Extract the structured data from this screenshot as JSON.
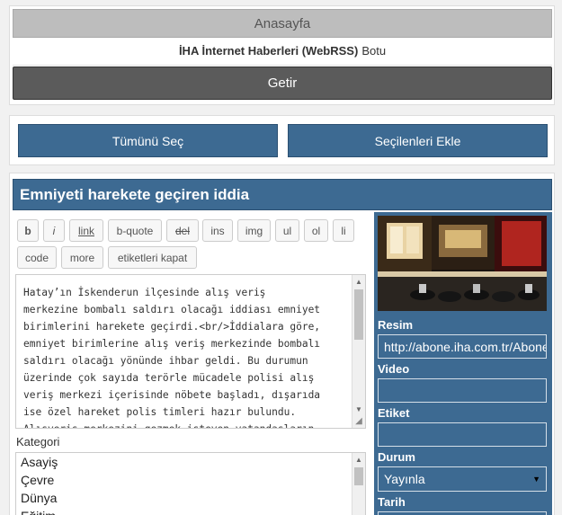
{
  "top": {
    "home_label": "Anasayfa",
    "bot_title_bold": "İHA İnternet Haberleri (WebRSS)",
    "bot_title_rest": "Botu",
    "fetch_label": "Getir"
  },
  "actions": {
    "select_all_label": "Tümünü Seç",
    "add_selected_label": "Seçilenleri Ekle"
  },
  "article": {
    "title": "Emniyeti harekete geçiren iddia",
    "toolbar": [
      "b",
      "i",
      "link",
      "b-quote",
      "del",
      "ins",
      "img",
      "ul",
      "ol",
      "li",
      "code",
      "more",
      "etiketleri kapat"
    ],
    "content_lines": [
      "Hatay’ın İskenderun ilçesinde alış veriş",
      "merkezine bombalı saldırı olacağı iddiası emniyet",
      "birimlerini harekete geçirdi.<br/>İddialara göre,",
      "emniyet birimlerine alış veriş merkezinde bombalı",
      "saldırı olacağı yönünde ihbar geldi. Bu durumun",
      "üzerinde çok sayıda terörle mücadele polisi alış",
      "veriş merkezi içerisinde nöbete başladı, dışarıda",
      "ise özel hareket polis timleri hazır bulundu.",
      "Alışveriş merkezini gezmek isteyen vatandaşların"
    ],
    "category_label": "Kategori",
    "categories": [
      "Asayiş",
      "Çevre",
      "Dünya",
      "Eğitim"
    ]
  },
  "sidebar": {
    "image_label": "Resim",
    "image_value": "http://abone.iha.com.tr/Abone/Images/",
    "video_label": "Video",
    "video_value": "",
    "tag_label": "Etiket",
    "tag_value": "",
    "status_label": "Durum",
    "status_value": "Yayınla",
    "date_label": "Tarih"
  }
}
